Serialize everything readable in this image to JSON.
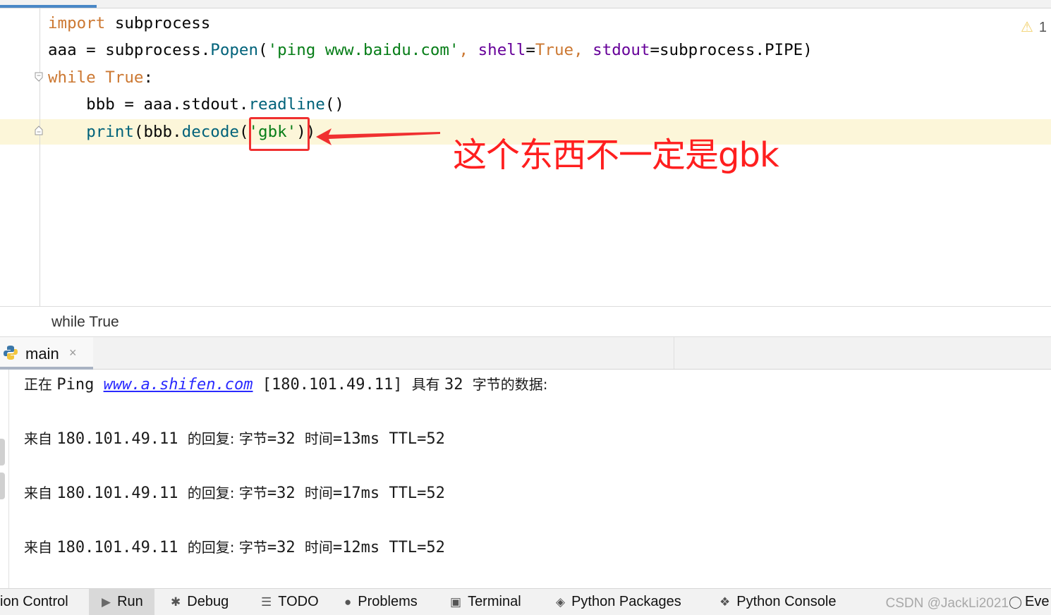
{
  "editor": {
    "lines": [
      {
        "parts": [
          {
            "t": "import",
            "c": "py-kw"
          },
          {
            "t": " subprocess",
            "c": ""
          }
        ]
      },
      {
        "parts": [
          {
            "t": "aaa = subprocess.",
            "c": ""
          },
          {
            "t": "Popen",
            "c": "fn"
          },
          {
            "t": "(",
            "c": ""
          },
          {
            "t": "'ping www.baidu.com'",
            "c": "str"
          },
          {
            "t": ", ",
            "c": "py-kw"
          },
          {
            "t": "shell",
            "c": "param"
          },
          {
            "t": "=",
            "c": ""
          },
          {
            "t": "True",
            "c": "py-kw"
          },
          {
            "t": ", ",
            "c": "py-kw"
          },
          {
            "t": "stdout",
            "c": "param"
          },
          {
            "t": "=subprocess.PIPE)",
            "c": ""
          }
        ]
      },
      {
        "parts": [
          {
            "t": "while",
            "c": "py-kw"
          },
          {
            "t": " ",
            "c": ""
          },
          {
            "t": "True",
            "c": "py-kw"
          },
          {
            "t": ":",
            "c": ""
          }
        ]
      },
      {
        "parts": [
          {
            "t": "    bbb = aaa.stdout.",
            "c": ""
          },
          {
            "t": "readline",
            "c": "fn"
          },
          {
            "t": "()",
            "c": ""
          }
        ]
      },
      {
        "parts": [
          {
            "t": "    ",
            "c": ""
          },
          {
            "t": "print",
            "c": "fn"
          },
          {
            "t": "(bbb.",
            "c": ""
          },
          {
            "t": "decode",
            "c": "fn"
          },
          {
            "t": "(",
            "c": ""
          },
          {
            "t": "'gbk'",
            "c": "str"
          },
          {
            "t": "))",
            "c": ""
          }
        ]
      }
    ],
    "warning_count": "1"
  },
  "annotation": {
    "text": "这个东西不一定是gbk",
    "color": "#ff1f1f"
  },
  "breadcrumb": {
    "text": "while True"
  },
  "run_panel": {
    "tab_label": "main",
    "close_glyph": "×"
  },
  "console": {
    "lines": [
      {
        "parts": [
          {
            "t": "正在 ",
            "c": "cjk"
          },
          {
            "t": "Ping ",
            "c": ""
          },
          {
            "t": "www.a.shifen.com",
            "c": "link"
          },
          {
            "t": " [180.101.49.11] ",
            "c": ""
          },
          {
            "t": "具有 ",
            "c": "cjk"
          },
          {
            "t": "32 ",
            "c": ""
          },
          {
            "t": "字节的数据:",
            "c": "cjk"
          }
        ]
      },
      {
        "parts": [
          {
            "t": "来自 ",
            "c": "cjk"
          },
          {
            "t": "180.101.49.11 ",
            "c": ""
          },
          {
            "t": "的回复: 字节",
            "c": "cjk"
          },
          {
            "t": "=32 ",
            "c": ""
          },
          {
            "t": "时间",
            "c": "cjk"
          },
          {
            "t": "=13ms TTL=52",
            "c": ""
          }
        ]
      },
      {
        "parts": [
          {
            "t": "来自 ",
            "c": "cjk"
          },
          {
            "t": "180.101.49.11 ",
            "c": ""
          },
          {
            "t": "的回复: 字节",
            "c": "cjk"
          },
          {
            "t": "=32 ",
            "c": ""
          },
          {
            "t": "时间",
            "c": "cjk"
          },
          {
            "t": "=17ms TTL=52",
            "c": ""
          }
        ]
      },
      {
        "parts": [
          {
            "t": "来自 ",
            "c": "cjk"
          },
          {
            "t": "180.101.49.11 ",
            "c": ""
          },
          {
            "t": "的回复: 字节",
            "c": "cjk"
          },
          {
            "t": "=32 ",
            "c": ""
          },
          {
            "t": "时间",
            "c": "cjk"
          },
          {
            "t": "=12ms TTL=52",
            "c": ""
          }
        ]
      }
    ]
  },
  "toolbar": {
    "items": [
      {
        "label": "ion Control",
        "icon": ""
      },
      {
        "label": "Run",
        "icon": "run-icon"
      },
      {
        "label": "Debug",
        "icon": "bug-icon"
      },
      {
        "label": "TODO",
        "icon": "list-icon"
      },
      {
        "label": "Problems",
        "icon": "problems-icon"
      },
      {
        "label": "Terminal",
        "icon": "terminal-icon"
      },
      {
        "label": "Python Packages",
        "icon": "packages-icon"
      },
      {
        "label": "Python Console",
        "icon": "python-icon"
      }
    ],
    "watermark": "CSDN @JackLi2021",
    "event_log": "Eve"
  }
}
